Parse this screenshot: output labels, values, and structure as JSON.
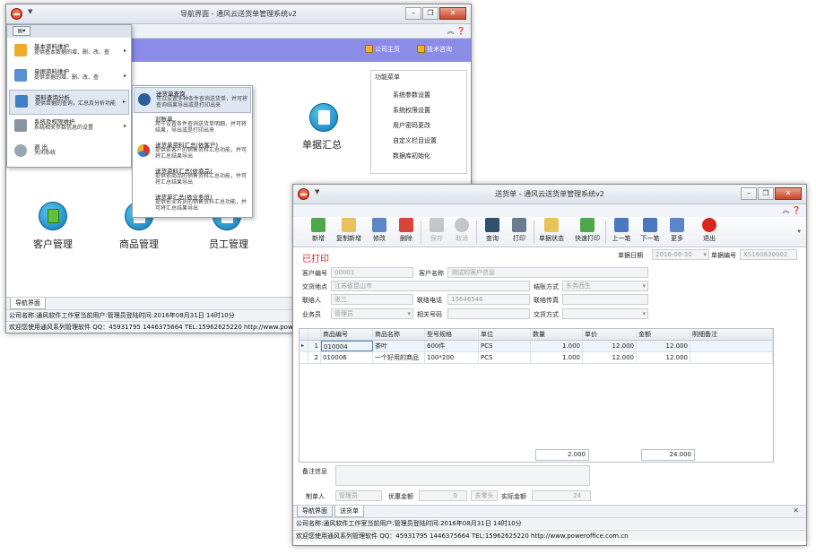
{
  "nav_window": {
    "title": "导航界面 - 通风云送货单管理系统v2",
    "links": [
      "公司主页",
      "技术咨询"
    ],
    "func_menu": {
      "header": "功能菜单",
      "items": [
        "系统参数设置",
        "系统权限设置",
        "用户密码更改",
        "自定义栏目设置",
        "数据库初始化"
      ]
    },
    "tiles": {
      "summary": "单据汇总",
      "customer": "客户管理",
      "product": "商品管理",
      "staff": "员工管理"
    },
    "main_menu": [
      {
        "title": "基本资料维护",
        "desc": "提供基本数据的增、删、改、查"
      },
      {
        "title": "单据资料维护",
        "desc": "提供单据的增、删、改、查"
      },
      {
        "title": "资料查询分析",
        "desc": "提供单据的查询，汇总及分析功能"
      },
      {
        "title": "系统及权限维护",
        "desc": "系统相关参数信息的设置"
      },
      {
        "title": "退 出",
        "desc": "关闭系统"
      }
    ],
    "submenu": [
      {
        "title": "送货单查询",
        "desc": "可以设置多种条件查询送货单，并可将查询结果导出或是打印出来"
      },
      {
        "title": "对账单",
        "desc": "用于设置条件查询送货单明细，并可将结果，导出或是打印出来"
      },
      {
        "title": "送货单资料汇总(依客户)",
        "desc": "提供依客户的销售资料汇总功能，并可将汇总结果导出"
      },
      {
        "title": "送货资料汇总(依商品)",
        "desc": "提供依商品的销售资料汇总功能，并可将汇总结果导出"
      },
      {
        "title": "送货单汇总(依业务员)",
        "desc": "提供依业务员的销售资料汇总功能，并可将汇总结果导出"
      }
    ],
    "tab": "导航界面",
    "status1": "公司名称:通风软件工作室当前用户:管理员登陆时间:2016年08月31日 14时10分",
    "status2": "欢迎您使用通风系列管理软件 QQ：45931795 1446375664 TEL:15962625220 http://www.poweroffice.com.cn"
  },
  "order_window": {
    "title": "送货单 - 通风云送货单管理系统v2",
    "toolbar": {
      "new": "新增",
      "copy_new": "复制新增",
      "edit": "修改",
      "delete": "删除",
      "save": "保存",
      "cancel": "取消",
      "query": "查询",
      "print": "打印",
      "doc_status": "单据状态",
      "quick_print": "快速打印",
      "prev": "上一笔",
      "next": "下一笔",
      "more": "更多",
      "exit": "退出"
    },
    "printed_label": "已打印",
    "header": {
      "date_label": "单据日期",
      "date_value": "2016-08-30",
      "docno_label": "单据编号",
      "docno_value": "XS160830002"
    },
    "form": {
      "cust_code_label": "客户编号",
      "cust_code": "00001",
      "cust_name_label": "客户名称",
      "cust_name": "测试的客户信息",
      "delivery_label": "交货地点",
      "delivery": "江苏省昆山市",
      "settle_label": "结账方式",
      "settle": "东务西生",
      "contact_label": "联络人",
      "contact": "张三",
      "phone_label": "联络电话",
      "phone": "15646546",
      "fax_label": "联络传真",
      "fax": "",
      "sales_label": "业务员",
      "sales": "管理员",
      "related_label": "相关号码",
      "related": "",
      "trade_label": "交货方式",
      "trade": ""
    },
    "grid": {
      "headers": [
        "",
        "",
        "商品编号",
        "商品名称",
        "型号规格",
        "单位",
        "数量",
        "单价",
        "金额",
        "明细备注"
      ],
      "rows": [
        {
          "marker": "▸",
          "no": "1",
          "code": "010004",
          "name": "茶叶",
          "spec": "600件",
          "unit": "PCS",
          "qty": "1.000",
          "price": "12.000",
          "amount": "12.000",
          "remark": ""
        },
        {
          "marker": "",
          "no": "2",
          "code": "010006",
          "name": "一个好用的商品",
          "spec": "100*200",
          "unit": "PCS",
          "qty": "1.000",
          "price": "12.000",
          "amount": "12.000",
          "remark": ""
        }
      ],
      "total_qty": "2.000",
      "total_amount": "24.000"
    },
    "footer": {
      "memo_label": "备注信息",
      "maker_label": "制单人",
      "maker": "管理员",
      "discount_label": "优惠金额",
      "discount": "0",
      "round_button": "去零头",
      "actual_label": "实际金额",
      "actual": "24"
    },
    "tabs": [
      "导航界面",
      "送货单"
    ],
    "status1": "公司名称:通风软件工作室当前用户:管理员登陆时间:2016年08月31日 14时10分",
    "status2": "欢迎您使用通风系列管理软件 QQ：45931795 1446375664 TEL:15962625220 http://www.poweroffice.com.cn"
  }
}
